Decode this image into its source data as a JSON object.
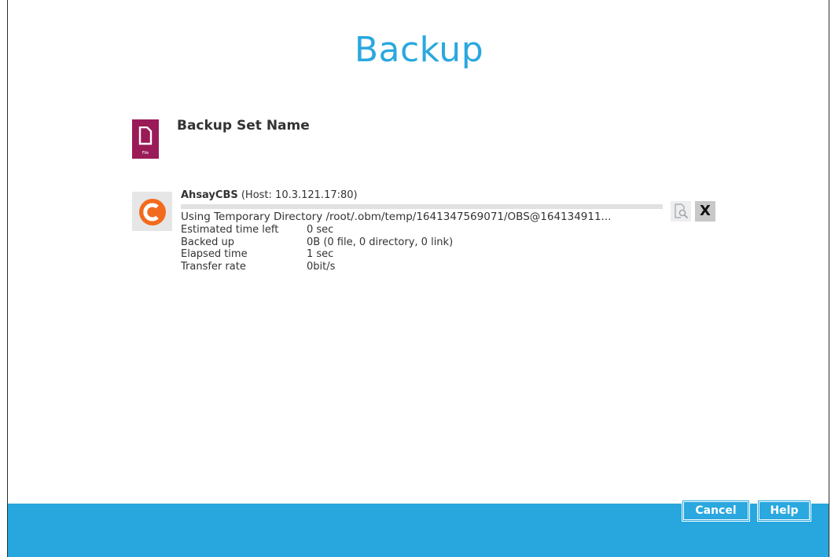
{
  "window": {
    "title": "Backup"
  },
  "backup_set": {
    "name_label": "Backup Set Name",
    "icon": "file-icon",
    "icon_caption": "File"
  },
  "destination": {
    "name": "AhsayCBS",
    "host": "(Host: 10.3.121.17:80)",
    "logo": "ahsay-c-logo-icon",
    "progress": 0,
    "status_message": "Using Temporary Directory /root/.obm/temp/1641347569071/OBS@164134911...",
    "stats": [
      {
        "label": "Estimated time left",
        "value": "0 sec"
      },
      {
        "label": "Backed up",
        "value": "0B (0 file, 0 directory, 0 link)"
      },
      {
        "label": "Elapsed time",
        "value": "1 sec"
      },
      {
        "label": "Transfer rate",
        "value": "0bit/s"
      }
    ],
    "actions": {
      "report_icon": "magnifier-report-icon",
      "cancel_label": "X"
    }
  },
  "footer": {
    "cancel_label": "Cancel",
    "help_label": "Help"
  },
  "colors": {
    "accent": "#2aa8df",
    "footer": "#27a7de",
    "file_icon_bg": "#9a1b57",
    "ahsay_orange": "#f26b1d"
  }
}
